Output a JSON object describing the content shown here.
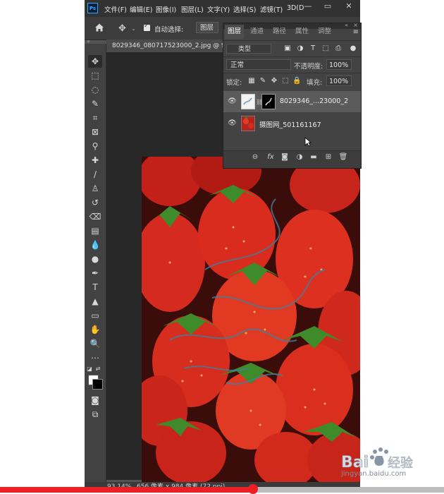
{
  "app": {
    "logo": "Ps",
    "menu": [
      "文件(F)",
      "编辑(E)",
      "图像(I)",
      "图层(L)",
      "文字(Y)",
      "选择(S)",
      "滤镜(T)",
      "3D(D"
    ],
    "window_controls": [
      "minimize",
      "restore",
      "close"
    ]
  },
  "options_bar": {
    "auto_select_label": "自动选择:",
    "auto_select_checked": true,
    "target": "图层"
  },
  "document": {
    "tab_title": "8029346_080717523000_2.jpg @ 93"
  },
  "status_bar": {
    "zoom": "93.14%",
    "info": "656 像素 x 984 像素 (72 ppi)"
  },
  "layers_panel": {
    "tabs": [
      "图层",
      "通道",
      "路径",
      "属性",
      "调整"
    ],
    "active_tab": "图层",
    "filter_kind": "类型",
    "blend_mode": "正常",
    "opacity_label": "不透明度:",
    "opacity": "100%",
    "lock_label": "锁定:",
    "fill_label": "填充:",
    "fill": "100%",
    "layers": [
      {
        "name": "8029346_...23000_2",
        "visible": true,
        "selected": true,
        "has_mask": true
      },
      {
        "name": "摄图网_501161167",
        "visible": true,
        "selected": false,
        "has_mask": false
      }
    ],
    "footer_icons": [
      "link-icon",
      "fx-icon",
      "mask-icon",
      "adjustment-icon",
      "group-icon",
      "new-layer-icon",
      "trash-icon"
    ]
  },
  "player": {
    "progress": 0.57,
    "next_icon": "chevron-right-icon"
  },
  "watermark": {
    "brand": "Baidu经验",
    "url": "jingyan.baidu.com"
  },
  "colors": {
    "accent": "#31a8ff",
    "progress": "#ee1f24",
    "panel_bg": "#434343",
    "app_bg": "#535353"
  }
}
